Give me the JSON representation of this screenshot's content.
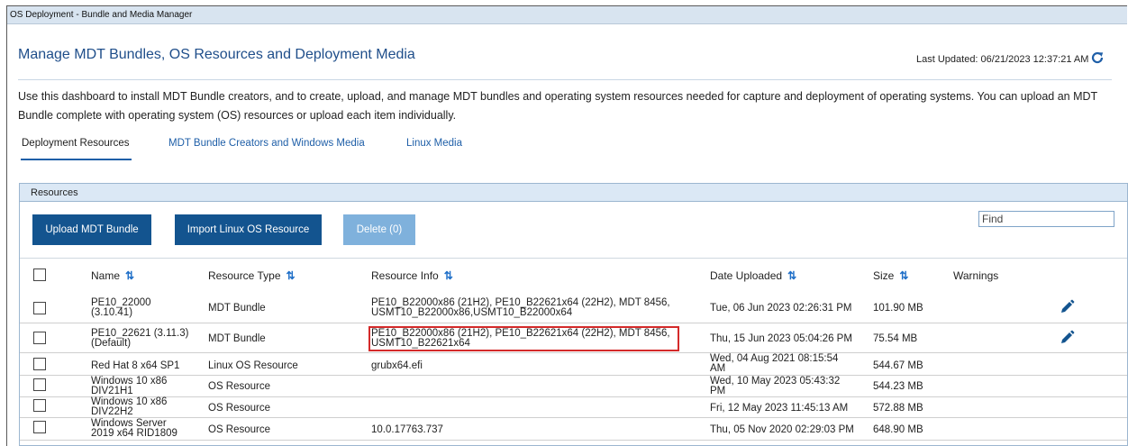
{
  "window": {
    "title": "OS Deployment - Bundle and Media Manager"
  },
  "header": {
    "title": "Manage MDT Bundles, OS Resources and Deployment Media",
    "last_updated": "Last Updated: 06/21/2023 12:37:21 AM"
  },
  "description": "Use this dashboard to install MDT Bundle creators, and to create, upload, and manage MDT bundles and operating system resources needed for capture and deployment of operating systems. You can upload an MDT Bundle complete with operating system (OS) resources or upload each item individually.",
  "tabs": [
    {
      "label": "Deployment Resources",
      "active": true
    },
    {
      "label": "MDT Bundle Creators and Windows Media",
      "active": false
    },
    {
      "label": "Linux Media",
      "active": false
    }
  ],
  "panel": {
    "title": "Resources"
  },
  "toolbar": {
    "upload_label": "Upload MDT Bundle",
    "import_label": "Import Linux OS Resource",
    "delete_label": "Delete (0)",
    "find_placeholder": "Find"
  },
  "columns": {
    "name": "Name",
    "resource_type": "Resource Type",
    "resource_info": "Resource Info",
    "date_uploaded": "Date Uploaded",
    "size": "Size",
    "warnings": "Warnings"
  },
  "rows": [
    {
      "name_1": "PE10_22000",
      "name_2": "(3.10.41)",
      "type": "MDT Bundle",
      "info_1": "PE10_B22000x86 (21H2), PE10_B22621x64 (22H2), MDT 8456,",
      "info_2": "USMT10_B22000x86,USMT10_B22000x64",
      "date_1": "Tue, 06 Jun 2023 02:26:31 PM",
      "date_2": "",
      "size": "101.90 MB",
      "editable": true
    },
    {
      "name_1": "PE10_22621 (3.11.3)",
      "name_2": "(Default)",
      "type": "MDT Bundle",
      "info_1": "PE10_B22000x86 (21H2), PE10_B22621x64 (22H2), MDT 8456,",
      "info_2": "USMT10_B22621x64",
      "date_1": "Thu, 15 Jun 2023 05:04:26 PM",
      "date_2": "",
      "size": "75.54 MB",
      "editable": true
    },
    {
      "name_1": "Red Hat 8 x64 SP1",
      "name_2": "",
      "type": "Linux OS Resource",
      "info_1": "grubx64.efi",
      "info_2": "",
      "date_1": "Wed, 04 Aug 2021 08:15:54",
      "date_2": "AM",
      "size": "544.67 MB",
      "editable": false
    },
    {
      "name_1": "Windows 10 x86",
      "name_2": "DIV21H1",
      "type": "OS Resource",
      "info_1": "",
      "info_2": "",
      "date_1": "Wed, 10 May 2023 05:43:32",
      "date_2": "PM",
      "size": "544.23 MB",
      "editable": false
    },
    {
      "name_1": "Windows 10 x86",
      "name_2": "DIV22H2",
      "type": "OS Resource",
      "info_1": "",
      "info_2": "",
      "date_1": "Fri, 12 May 2023 11:45:13 AM",
      "date_2": "",
      "size": "572.88 MB",
      "editable": false
    },
    {
      "name_1": "Windows Server",
      "name_2": "2019 x64 RID1809",
      "type": "OS Resource",
      "info_1": "10.0.17763.737",
      "info_2": "",
      "date_1": "Thu, 05 Nov 2020 02:29:03 PM",
      "date_2": "",
      "size": "648.90 MB",
      "editable": false
    }
  ],
  "colors": {
    "accent": "#13548f",
    "link": "#1f5fa8",
    "highlight": "#d42a2a",
    "title_bar": "#d8e4f0"
  }
}
